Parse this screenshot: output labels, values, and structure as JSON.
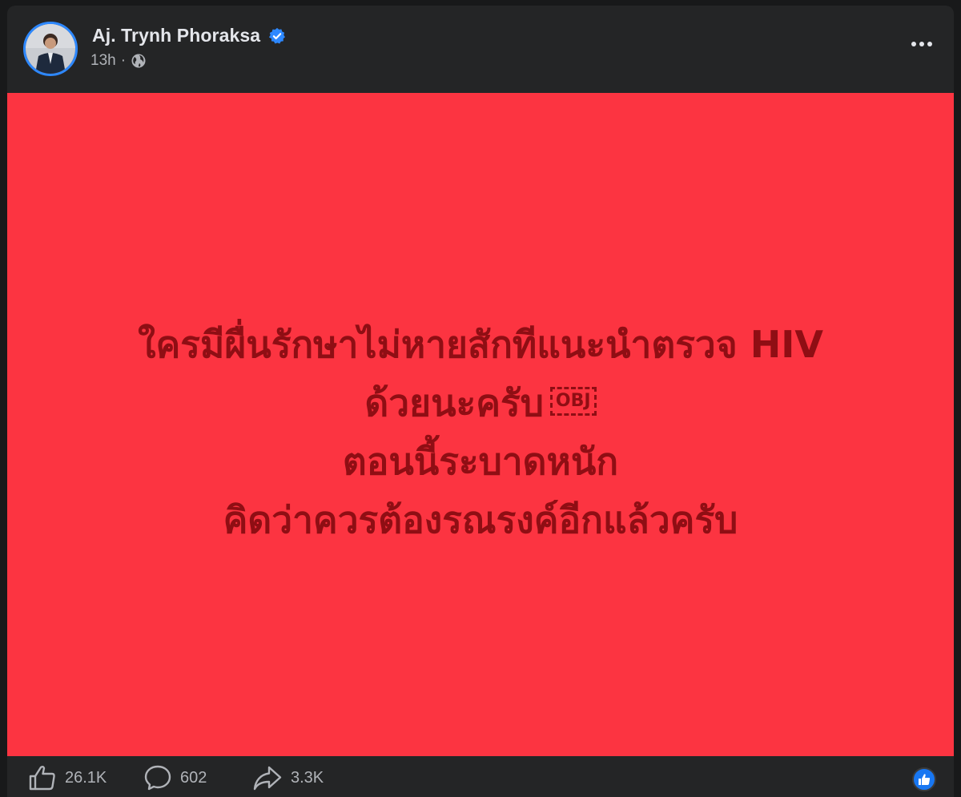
{
  "post": {
    "author_name": "Aj. Trynh Phoraksa",
    "timestamp": "13h",
    "separator": "·",
    "audience_icon": "globe-icon",
    "verified_icon": "verified-badge-icon",
    "more_icon": "more-options-icon"
  },
  "image_text": {
    "line1": "ใครมีผื่นรักษาไม่หายสักทีแนะนำตรวจ HIV",
    "line2": "ด้วยนะครับ",
    "line2_obj": "OBJ",
    "line3": "ตอนนี้ระบาดหนัก",
    "line4": "คิดว่าควรต้องรณรงค์อีกแล้วครับ",
    "background_color": "#fc3441",
    "text_color": "#8f0e14"
  },
  "footer": {
    "likes": "26.1K",
    "comments": "602",
    "shares": "3.3K",
    "like_icon": "thumbs-up-icon",
    "comment_icon": "comment-icon",
    "share_icon": "share-icon",
    "reaction_icon": "like-reaction-icon"
  },
  "colors": {
    "accent": "#1877f2",
    "card_bg": "#242526",
    "text_primary": "#e4e6eb",
    "text_secondary": "#b0b3b8"
  }
}
